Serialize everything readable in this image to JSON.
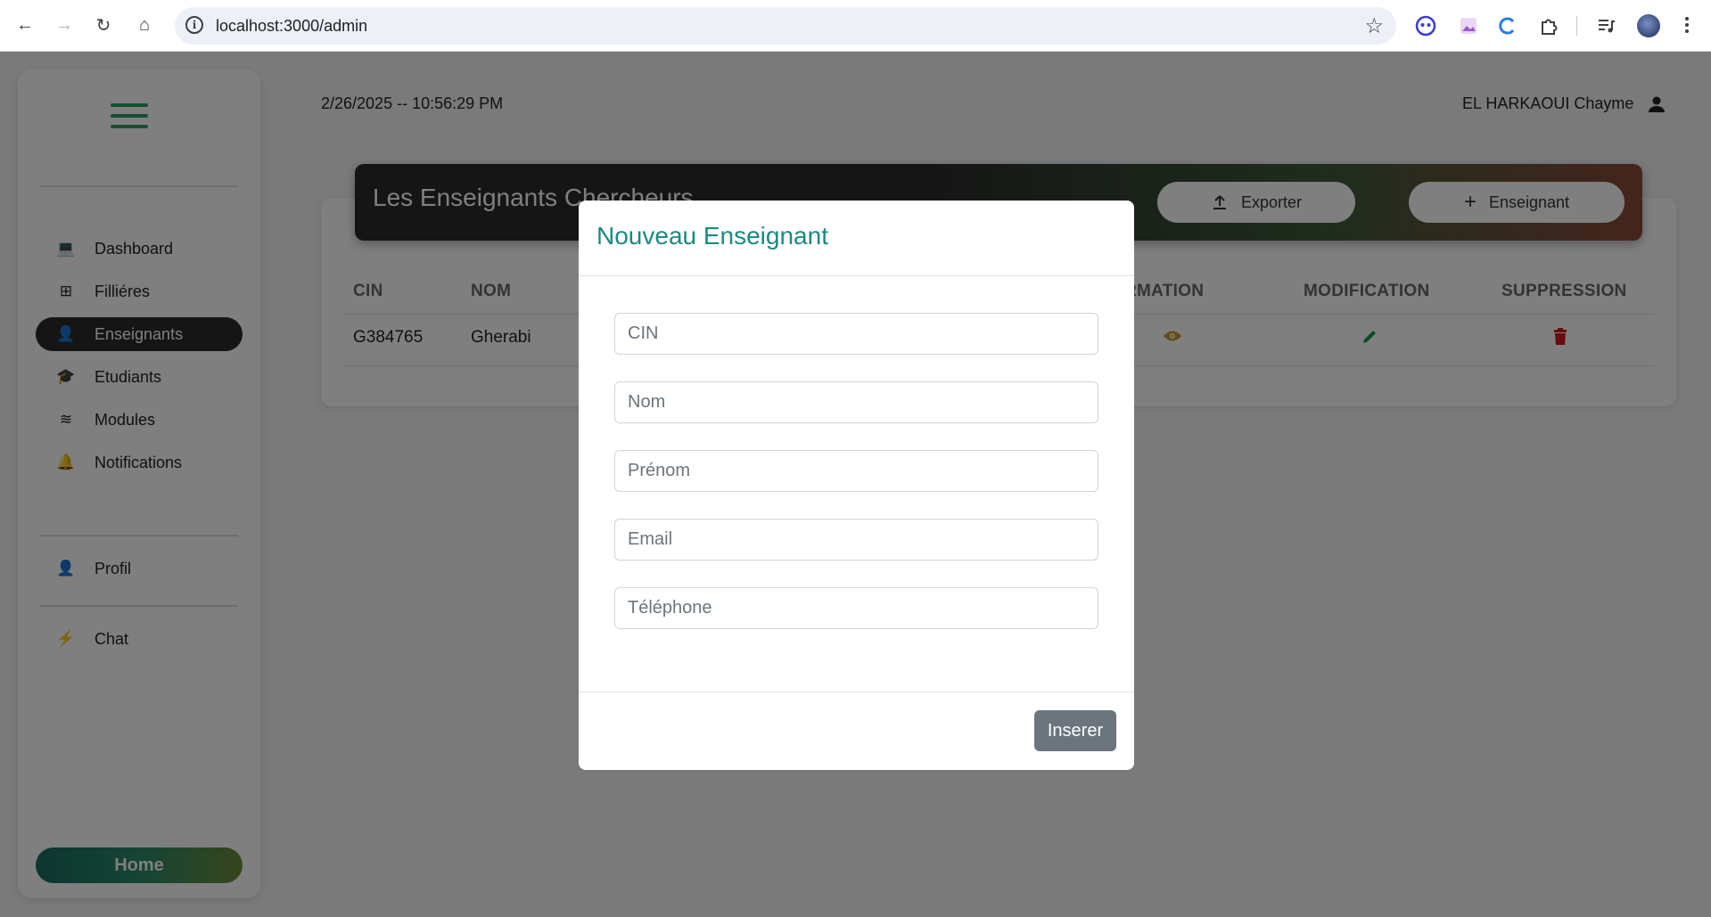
{
  "browser": {
    "url": "localhost:3000/admin",
    "back_icon": "←",
    "forward_icon": "→",
    "reload_icon": "↻",
    "home_icon": "⌂",
    "info_icon": "i",
    "star_icon": "☆"
  },
  "sidebar": {
    "items": [
      {
        "label": "Dashboard",
        "icon": "💻"
      },
      {
        "label": "Filliéres",
        "icon": "⊞"
      },
      {
        "label": "Enseignants",
        "icon": "👤"
      },
      {
        "label": "Etudiants",
        "icon": "🎓"
      },
      {
        "label": "Modules",
        "icon": "≋"
      },
      {
        "label": "Notifications",
        "icon": "🔔"
      }
    ],
    "profile": {
      "label": "Profil",
      "icon": "👤"
    },
    "chat": {
      "label": "Chat",
      "icon": "⚡"
    },
    "home_label": "Home"
  },
  "header": {
    "datetime": "2/26/2025 -- 10:56:29 PM",
    "user_name": "EL HARKAOUI Chayme"
  },
  "banner": {
    "title": "Les Enseignants Chercheurs",
    "export_label": "Exporter",
    "add_label": "Enseignant"
  },
  "table": {
    "headers": [
      "CIN",
      "NOM",
      "FORMATION",
      "MODIFICATION",
      "SUPPRESSION"
    ],
    "rows": [
      {
        "cin": "G384765",
        "nom": "Gherabi"
      }
    ]
  },
  "modal": {
    "title": "Nouveau Enseignant",
    "fields": [
      {
        "placeholder": "CIN",
        "value": ""
      },
      {
        "placeholder": "Nom",
        "value": ""
      },
      {
        "placeholder": "Prénom",
        "value": ""
      },
      {
        "placeholder": "Email",
        "value": ""
      },
      {
        "placeholder": "Téléphone",
        "value": ""
      }
    ],
    "submit_label": "Inserer"
  },
  "colors": {
    "accent": "#1a8a80",
    "active_menu": "#2b2b2b",
    "insert_button": "#6c757d",
    "eye_icon": "#c89a2a",
    "edit_icon": "#1a9a4a",
    "delete_icon": "#d01818"
  }
}
